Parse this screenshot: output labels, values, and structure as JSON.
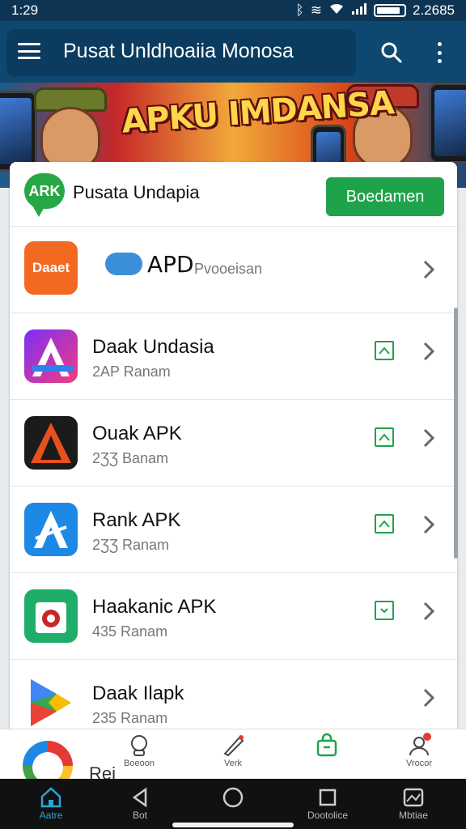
{
  "status": {
    "time": "1:29",
    "right_text": "2.2685",
    "icons": [
      "bluetooth-icon",
      "vibrate-icon",
      "wifi-icon",
      "signal-icon",
      "battery-icon"
    ]
  },
  "appbar": {
    "title": "Pusat Unldhoaiia Monosa",
    "icons": [
      "menu-icon",
      "search-icon",
      "more-vertical-icon"
    ]
  },
  "banner": {
    "headline": "APKU IMDANSA"
  },
  "header": {
    "title": "Pusata Undapia",
    "button": "Boedamen",
    "logo_text": "ARK"
  },
  "list": [
    {
      "logo": "Daaet",
      "title": "APD",
      "subtitle": "Pvooeisan",
      "status": "none"
    },
    {
      "title": "Daak Undasia",
      "subtitle": "2AP Ranam",
      "status": "up"
    },
    {
      "title": "Ouak APK",
      "subtitle": "2ƷƷ Banam",
      "status": "up"
    },
    {
      "title": "Rank APK",
      "subtitle": "2ƷƷ Ranam",
      "status": "up"
    },
    {
      "title": "Haakanic APK",
      "subtitle": "435 Ranam",
      "status": "down"
    },
    {
      "title": "Daak Ilapk",
      "subtitle": "235 Ranam",
      "status": "none"
    }
  ],
  "partial_row": {
    "label": "Rei"
  },
  "tabs": [
    {
      "label": "Boeoon"
    },
    {
      "label": "Verk"
    },
    {
      "label": ""
    },
    {
      "label": "Vrocor"
    }
  ],
  "nav": [
    {
      "label": "Aatre"
    },
    {
      "label": "Bot"
    },
    {
      "label": ""
    },
    {
      "label": "Dootolice"
    },
    {
      "label": "Mbtiae"
    }
  ],
  "colors": {
    "primary": "#0e4870",
    "accent_green": "#1ea34b",
    "nav_active": "#2aa6d9"
  }
}
